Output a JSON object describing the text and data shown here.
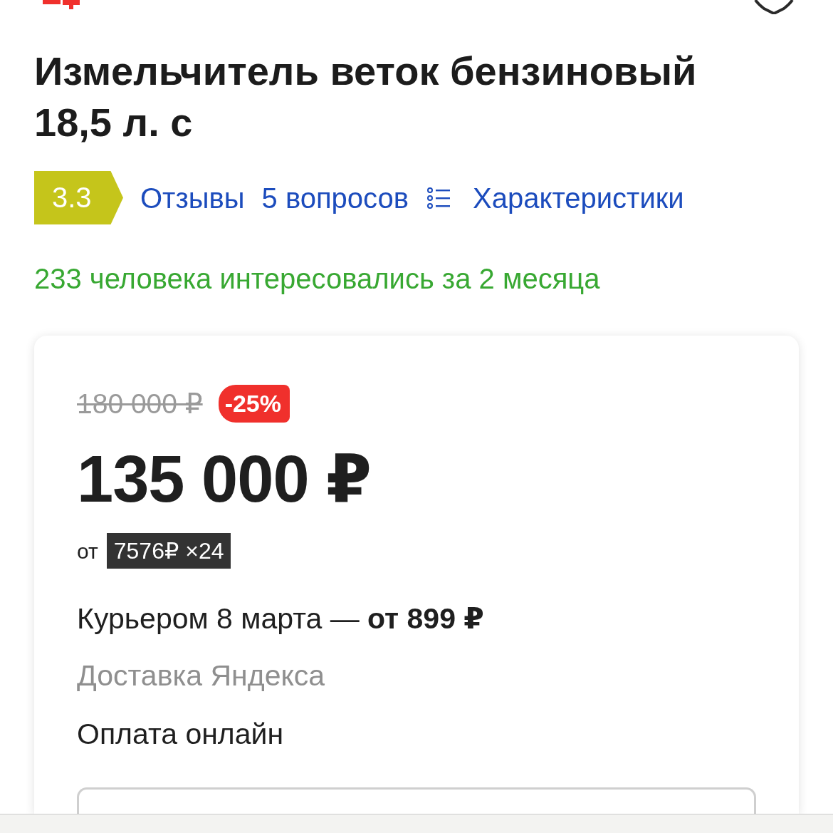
{
  "product": {
    "title": "Измельчитель веток бензиновый 18,5 л. с"
  },
  "rating": {
    "value": "3.3"
  },
  "links": [
    {
      "kind": "reviews",
      "label": "Отзывы"
    },
    {
      "kind": "questions",
      "label": "5 вопросов"
    },
    {
      "kind": "specs",
      "label": "Характеристики"
    }
  ],
  "interest": "233 человека интересовались за 2 месяца",
  "offer": {
    "old_price": "180 000 ₽",
    "discount": "-25%",
    "price": "135 000 ₽",
    "installment_prefix": "от",
    "installment": "7576₽ ×24",
    "delivery": "Курьером 8 марта — **от 899 ₽**",
    "delivery_service": "Доставка Яндекса",
    "payment": "Оплата онлайн"
  }
}
